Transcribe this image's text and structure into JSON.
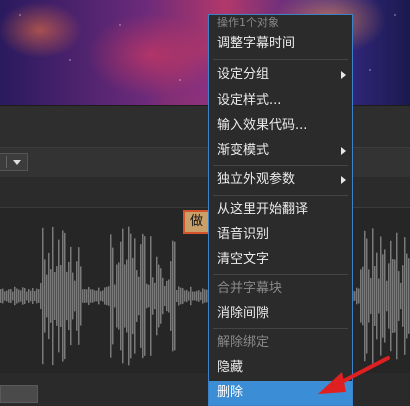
{
  "subtitle_block": {
    "text": "做"
  },
  "context_menu": {
    "header": "操作1个对象",
    "items": [
      {
        "label": "调整字幕时间"
      },
      {
        "label": "设定分组"
      },
      {
        "label": "设定样式..."
      },
      {
        "label": "输入效果代码..."
      },
      {
        "label": "渐变模式"
      },
      {
        "label": "独立外观参数"
      },
      {
        "label": "从这里开始翻译"
      },
      {
        "label": "语音识别"
      },
      {
        "label": "清空文字"
      },
      {
        "label": "合并字幕块"
      },
      {
        "label": "消除间隙"
      },
      {
        "label": "解除绑定"
      },
      {
        "label": "隐藏"
      },
      {
        "label": "删除"
      }
    ]
  },
  "colors": {
    "accent": "#3b8ed6",
    "annotation_arrow": "#e02020",
    "highlight_border": "#d4532a"
  }
}
